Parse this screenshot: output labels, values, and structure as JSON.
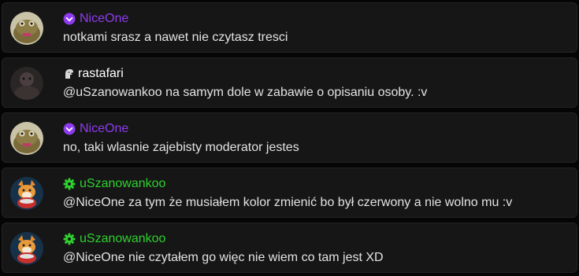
{
  "colors": {
    "purple": "#8e3bf0",
    "white": "#ffffff",
    "green": "#2fd02f",
    "text": "#e3e3e3"
  },
  "messages": [
    {
      "username": "NiceOne",
      "name_color": "#8e3bf0",
      "badge": "verified-check-icon",
      "text": "notkami srasz a nawet nie czytasz tresci"
    },
    {
      "username": "rastafari",
      "name_color": "#ffffff",
      "badge": "knight-helmet-icon",
      "text": "@uSzanowankoo na samym dole w zabawie o opisaniu osoby. :v"
    },
    {
      "username": "NiceOne",
      "name_color": "#8e3bf0",
      "badge": "verified-check-icon",
      "text": "no, taki wlasnie zajebisty moderator jestes"
    },
    {
      "username": "uSzanowankoo",
      "name_color": "#2fd02f",
      "badge": "moderator-gear-icon",
      "text": "@NiceOne za tym że musiałem kolor zmienić bo był czerwony a nie wolno mu :v"
    },
    {
      "username": "uSzanowankoo",
      "name_color": "#2fd02f",
      "badge": "moderator-gear-icon",
      "text": "@NiceOne nie czytałem go więc nie wiem co tam jest XD"
    }
  ]
}
